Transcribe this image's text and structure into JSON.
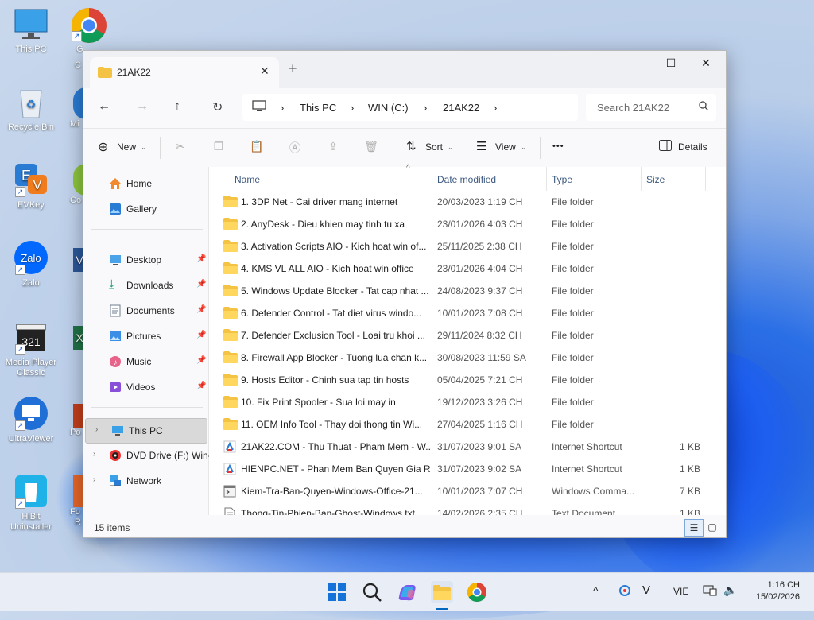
{
  "desktop": {
    "icons": [
      {
        "label": "This PC"
      },
      {
        "label": "Recycle Bin"
      },
      {
        "label": "EVKey"
      },
      {
        "label": "Zalo"
      },
      {
        "label": "Media Player Classic"
      },
      {
        "label": "UltraViewer"
      },
      {
        "label": "HiBit Uninstaller"
      }
    ],
    "partial_labels": [
      "G",
      "C",
      "Mi",
      "Co",
      "V",
      "X",
      "Po",
      "Fo",
      "R"
    ]
  },
  "window": {
    "tab_title": "21AK22",
    "tab_close": "✕",
    "new_tab": "+",
    "controls": {
      "minimize": "—",
      "maximize": "☐",
      "close": "✕"
    },
    "breadcrumb": [
      "This PC",
      "WIN (C:)",
      "21AK22"
    ],
    "search_placeholder": "Search 21AK22",
    "toolbar": {
      "new_label": "New",
      "sort_label": "Sort",
      "view_label": "View",
      "more_label": "•••",
      "details_label": "Details"
    },
    "nav": {
      "home": "Home",
      "gallery": "Gallery",
      "desktop": "Desktop",
      "downloads": "Downloads",
      "documents": "Documents",
      "pictures": "Pictures",
      "music": "Music",
      "videos": "Videos",
      "this_pc": "This PC",
      "dvd": "DVD Drive (F:) Win-",
      "network": "Network"
    },
    "columns": {
      "name": "Name",
      "date": "Date modified",
      "type": "Type",
      "size": "Size"
    },
    "files": [
      {
        "name": "1. 3DP Net - Cai driver mang internet",
        "date": "20/03/2023 1:19 CH",
        "type": "File folder",
        "size": "",
        "kind": "folder"
      },
      {
        "name": "2. AnyDesk - Dieu khien may tinh tu xa",
        "date": "23/01/2026 4:03 CH",
        "type": "File folder",
        "size": "",
        "kind": "folder"
      },
      {
        "name": "3. Activation Scripts AIO - Kich hoat win of...",
        "date": "25/11/2025 2:38 CH",
        "type": "File folder",
        "size": "",
        "kind": "folder"
      },
      {
        "name": "4. KMS VL ALL AIO - Kich hoat win office",
        "date": "23/01/2026 4:04 CH",
        "type": "File folder",
        "size": "",
        "kind": "folder"
      },
      {
        "name": "5. Windows Update Blocker - Tat cap nhat ...",
        "date": "24/08/2023 9:37 CH",
        "type": "File folder",
        "size": "",
        "kind": "folder"
      },
      {
        "name": "6. Defender Control - Tat diet virus windo...",
        "date": "10/01/2023 7:08 CH",
        "type": "File folder",
        "size": "",
        "kind": "folder"
      },
      {
        "name": "7. Defender Exclusion Tool - Loai tru khoi ...",
        "date": "29/11/2024 8:32 CH",
        "type": "File folder",
        "size": "",
        "kind": "folder"
      },
      {
        "name": "8. Firewall App Blocker - Tuong lua chan k...",
        "date": "30/08/2023 11:59 SA",
        "type": "File folder",
        "size": "",
        "kind": "folder"
      },
      {
        "name": "9. Hosts Editor - Chinh sua tap tin hosts",
        "date": "05/04/2025 7:21 CH",
        "type": "File folder",
        "size": "",
        "kind": "folder"
      },
      {
        "name": "10. Fix Print Spooler - Sua loi may in",
        "date": "19/12/2023 3:26 CH",
        "type": "File folder",
        "size": "",
        "kind": "folder"
      },
      {
        "name": "11. OEM Info Tool - Thay doi thong tin Wi...",
        "date": "27/04/2025 1:16 CH",
        "type": "File folder",
        "size": "",
        "kind": "folder"
      },
      {
        "name": "21AK22.COM - Thu Thuat - Pham Mem - W...",
        "date": "31/07/2023 9:01 SA",
        "type": "Internet Shortcut",
        "size": "1 KB",
        "kind": "url"
      },
      {
        "name": "HIENPC.NET - Phan Mem Ban Quyen Gia Re",
        "date": "31/07/2023 9:02 SA",
        "type": "Internet Shortcut",
        "size": "1 KB",
        "kind": "url"
      },
      {
        "name": "Kiem-Tra-Ban-Quyen-Windows-Office-21...",
        "date": "10/01/2023 7:07 CH",
        "type": "Windows Comma...",
        "size": "7 KB",
        "kind": "cmd"
      },
      {
        "name": "Thong-Tin-Phien-Ban-Ghost-Windows.txt",
        "date": "14/02/2026 2:35 CH",
        "type": "Text Document",
        "size": "1 KB",
        "kind": "txt"
      }
    ],
    "status": "15 items"
  },
  "taskbar": {
    "lang": "VIE",
    "time": "1:16 CH",
    "date": "15/02/2026",
    "colors": {
      "accent": "#0067c0",
      "folder": "#f5c344"
    }
  }
}
